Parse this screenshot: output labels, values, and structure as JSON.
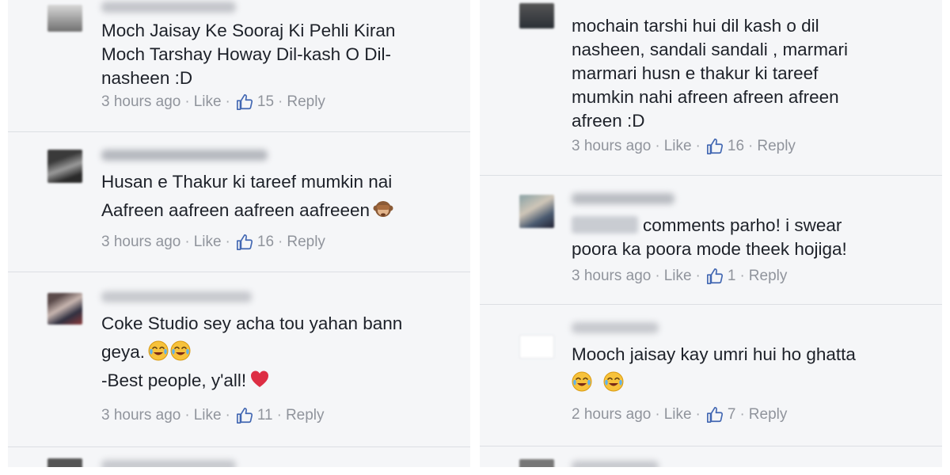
{
  "left": {
    "comments": [
      {
        "lines": [
          "Moch Jaisay Ke Sooraj Ki Pehli Kiran",
          "Moch Tarshay Howay Dil-kash O Dil-",
          "nasheen :D"
        ],
        "time": "3 hours ago",
        "like_label": "Like",
        "likes": "15",
        "reply_label": "Reply"
      },
      {
        "lines": [
          "Husan e Thakur ki tareef mumkin nai",
          "Aafreen aafreen aafreen aafreeen"
        ],
        "emoji_icon": "see-no-evil-monkey-icon",
        "time": "3 hours ago",
        "like_label": "Like",
        "likes": "16",
        "reply_label": "Reply"
      },
      {
        "lines": [
          "Coke Studio sey acha tou yahan bann",
          "geya.",
          "-Best people, y'all!"
        ],
        "emoji_icons": [
          "tears-of-joy-icon",
          "tears-of-joy-icon",
          "red-heart-icon"
        ],
        "time": "3 hours ago",
        "like_label": "Like",
        "likes": "11",
        "reply_label": "Reply"
      }
    ]
  },
  "right": {
    "comments": [
      {
        "lines": [
          "mochain tarshi hui dil kash o dil",
          "nasheen, sandali sandali , marmari",
          "marmari husn e thakur ki tareef",
          "mumkin nahi afreen afreen afreen",
          "afreen :D"
        ],
        "time": "3 hours ago",
        "like_label": "Like",
        "likes": "16",
        "reply_label": "Reply"
      },
      {
        "lines": [
          "comments parho! i swear",
          "poora ka poora mode theek hojiga!"
        ],
        "time": "3 hours ago",
        "like_label": "Like",
        "likes": "1",
        "reply_label": "Reply"
      },
      {
        "lines": [
          "Mooch jaisay kay umri hui ho ghatta"
        ],
        "emoji_icons": [
          "tears-of-joy-icon",
          "tears-of-joy-icon"
        ],
        "time": "2 hours ago",
        "like_label": "Like",
        "likes": "7",
        "reply_label": "Reply"
      }
    ]
  },
  "colors": {
    "background": "#f5f6f8",
    "text": "#1d2129",
    "meta": "#90949c",
    "like_blue": "#4267b2",
    "divider": "#dcdfe4"
  }
}
